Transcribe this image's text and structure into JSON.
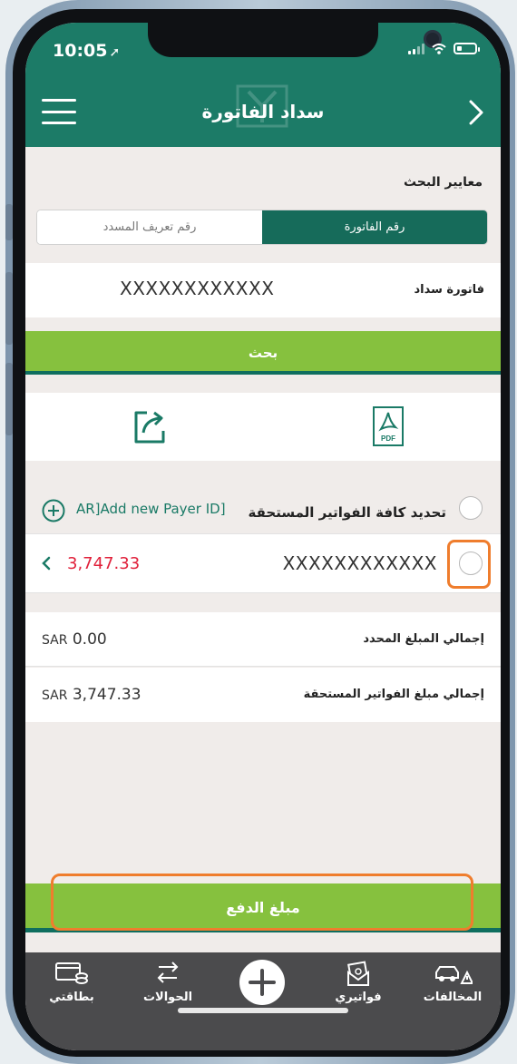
{
  "status": {
    "time": "10:05"
  },
  "header": {
    "title": "سداد الفاتورة"
  },
  "search": {
    "criteria_label": "معايير البحث",
    "tabs": [
      {
        "label": "رقم الفاتورة",
        "active": true
      },
      {
        "label": "رقم تعريف المسدد",
        "active": false
      }
    ],
    "invoice_label": "فاتورة سداد",
    "invoice_value": "XXXXXXXXXXXX",
    "search_button": "بحث"
  },
  "actions": {
    "pdf_text": "PDF"
  },
  "bills": {
    "add_payer_label": "AR]Add new Payer ID]",
    "select_all_label": "تحديد كافة الفواتير المستحقة",
    "items": [
      {
        "number": "XXXXXXXXXXXX",
        "amount": "3,747.33"
      }
    ]
  },
  "totals": {
    "selected_label": "إجمالي المبلغ المحدد",
    "selected_currency": "SAR",
    "selected_value": "0.00",
    "due_label": "إجمالي مبلغ الفواتير المستحقة",
    "due_currency": "SAR",
    "due_value": "3,747.33"
  },
  "pay_button": "مبلغ الدفع",
  "tabbar": {
    "items": [
      {
        "label": "بطاقتي",
        "icon": "wallet-icon"
      },
      {
        "label": "الحوالات",
        "icon": "transfer-icon"
      },
      {
        "label": "",
        "icon": "plus-icon"
      },
      {
        "label": "فواتيري",
        "icon": "bills-icon"
      },
      {
        "label": "المخالفات",
        "icon": "car-warning-icon"
      }
    ]
  },
  "colors": {
    "header": "#1c7b67",
    "accent_green": "#86c13e",
    "dark_green": "#166b5a",
    "amount_red": "#e0203a",
    "highlight_orange": "#ef7d2d",
    "tabbar": "#4b4b4d"
  }
}
